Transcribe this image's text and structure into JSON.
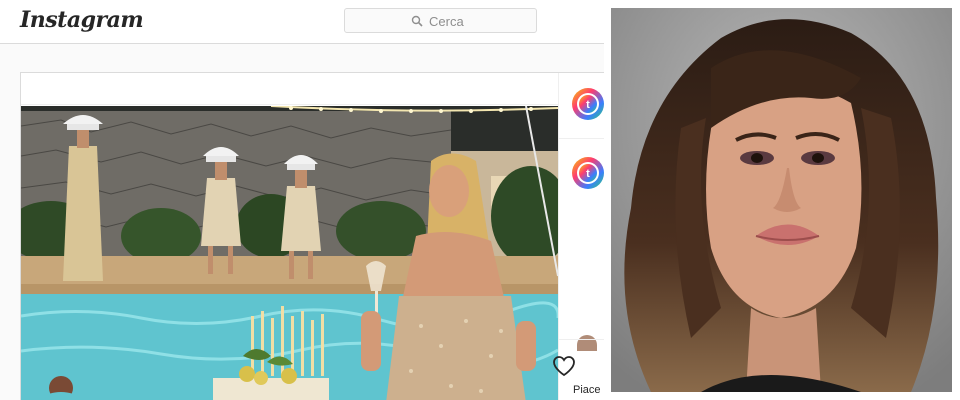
{
  "header": {
    "logo_text": "Instagram",
    "search_placeholder": "Cerca"
  },
  "post": {
    "likes_label": "Piace"
  },
  "icons": {
    "search": "search-icon",
    "heart": "heart-icon",
    "avatar": "rainbow-avatar-icon"
  },
  "colors": {
    "header_border": "#dbdbdb",
    "text_primary": "#262626",
    "text_muted": "#8e8e8e",
    "pool": "#5fc4cf"
  }
}
